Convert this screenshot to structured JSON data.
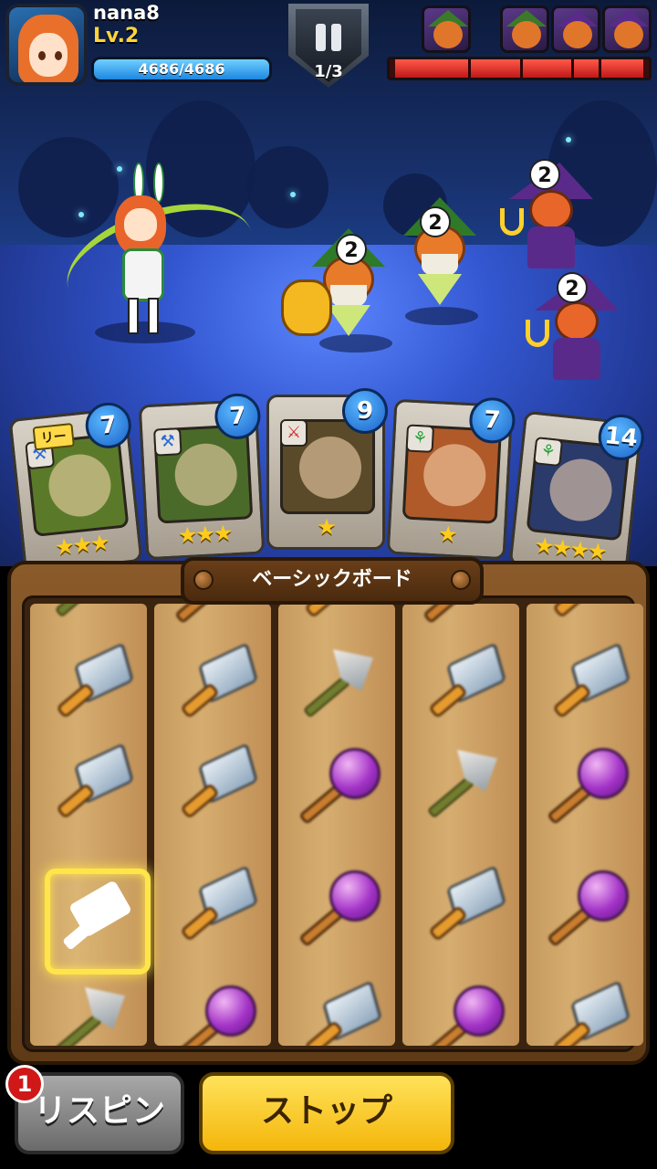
{
  "player": {
    "name": "nana8",
    "level": "Lv.2",
    "hp_text": "4686/4686",
    "hp_fraction": 1.0
  },
  "battle": {
    "wave": "1/3",
    "pause_icon": "pause-icon",
    "enemy_hp_fraction": 0.98,
    "enemy_portraits": [
      "pumpkin-warrior",
      "pumpkin-warrior",
      "pumpkin-witch",
      "pumpkin-witch"
    ],
    "enemy_levels": [
      "2",
      "2",
      "2",
      "2"
    ]
  },
  "cards": [
    {
      "leader_label": "リー",
      "cost": "7",
      "element_icon": "blue-hammer-icon",
      "stars": "★★★",
      "art_color": "#5a7a2a"
    },
    {
      "cost": "7",
      "element_icon": "blue-hammer-icon",
      "stars": "★★★",
      "art_color": "#4a6a2a"
    },
    {
      "cost": "9",
      "element_icon": "red-sword-icon",
      "stars": "★",
      "art_color": "#5a4a2a"
    },
    {
      "cost": "7",
      "element_icon": "green-axe-icon",
      "stars": "★",
      "art_color": "#b05a2a"
    },
    {
      "cost": "14",
      "element_icon": "green-axe-icon",
      "stars": "★★★★",
      "art_color": "#2a3a6a"
    }
  ],
  "board": {
    "title": "ベーシックボード",
    "reels": [
      [
        "sword",
        "sword",
        "hammer-highlight",
        "axe"
      ],
      [
        "sword",
        "sword",
        "sword",
        "wand"
      ],
      [
        "axe",
        "wand",
        "wand",
        "sword"
      ],
      [
        "sword",
        "axe",
        "sword",
        "wand"
      ],
      [
        "sword",
        "wand",
        "wand",
        "sword"
      ]
    ]
  },
  "buttons": {
    "respin_label": "リスピン",
    "respin_badge": "1",
    "stop_label": "ストップ"
  }
}
